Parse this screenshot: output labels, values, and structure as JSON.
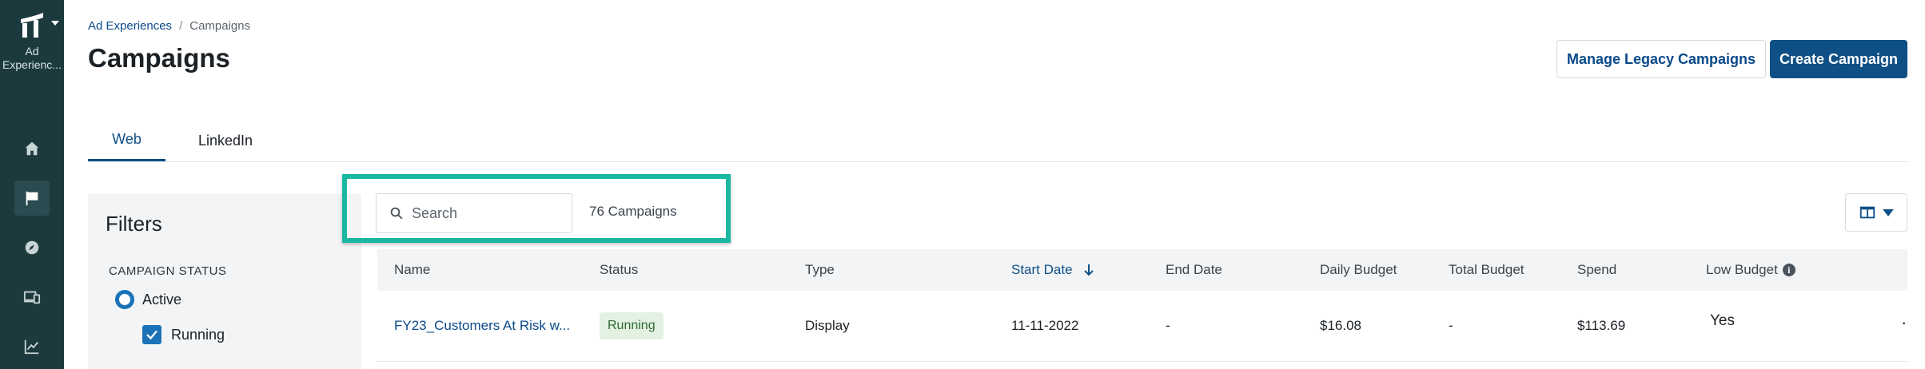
{
  "rail": {
    "app_label_line1": "Ad",
    "app_label_line2": "Experienc...",
    "items": [
      {
        "icon": "home-icon"
      },
      {
        "icon": "flag-icon",
        "active": true
      },
      {
        "icon": "compass-icon"
      },
      {
        "icon": "devices-icon"
      },
      {
        "icon": "chart-icon"
      }
    ]
  },
  "breadcrumb": {
    "parent": "Ad Experiences",
    "separator": "/",
    "current": "Campaigns"
  },
  "page_title": "Campaigns",
  "header_buttons": {
    "legacy": "Manage Legacy Campaigns",
    "create": "Create Campaign"
  },
  "tabs": [
    {
      "label": "Web",
      "active": true
    },
    {
      "label": "LinkedIn",
      "active": false
    }
  ],
  "filters": {
    "title": "Filters",
    "section": "CAMPAIGN STATUS",
    "radio_label": "Active",
    "checkbox_label": "Running"
  },
  "search": {
    "placeholder": "Search"
  },
  "count_label": "76 Campaigns",
  "table": {
    "columns": {
      "name": "Name",
      "status": "Status",
      "type": "Type",
      "start_date": "Start Date",
      "end_date": "End Date",
      "daily_budget": "Daily Budget",
      "total_budget": "Total Budget",
      "spend": "Spend",
      "low_budget": "Low Budget"
    },
    "rows": [
      {
        "name": "FY23_Customers At Risk w...",
        "status": "Running",
        "type": "Display",
        "start_date": "11-11-2022",
        "end_date": "-",
        "daily_budget": "$16.08",
        "total_budget": "-",
        "spend": "$113.69",
        "low_budget": "Yes"
      }
    ]
  },
  "colors": {
    "rail": "#1c3a3d",
    "primary": "#0e4f86",
    "highlight": "#1ab8a0",
    "running_pill": "#e3f1e3"
  }
}
